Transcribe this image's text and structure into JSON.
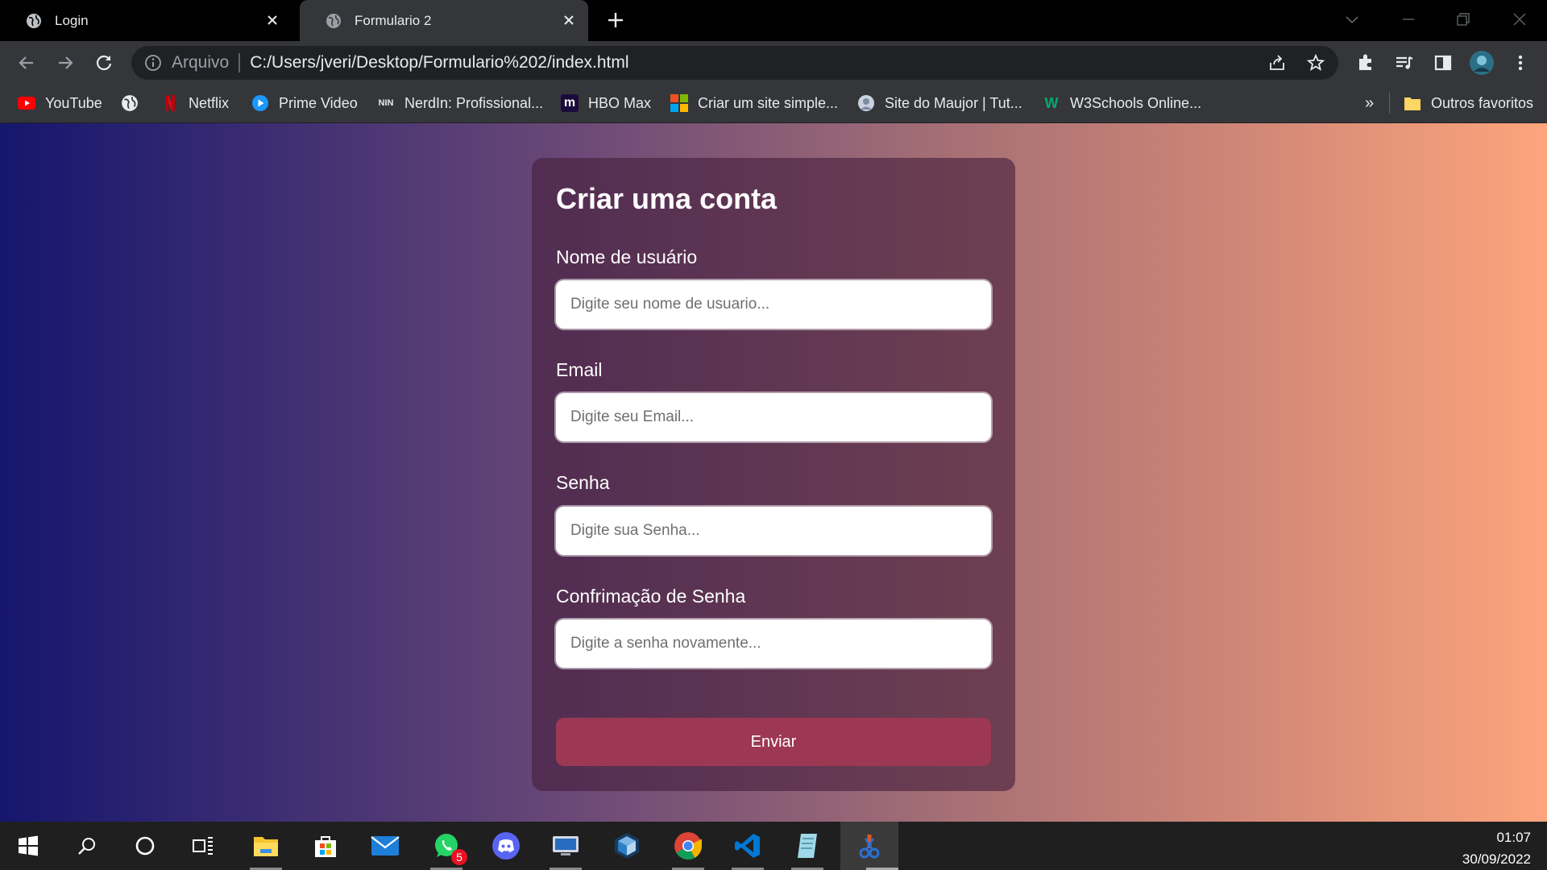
{
  "browser": {
    "tabs": [
      {
        "title": "Login",
        "active": false
      },
      {
        "title": "Formulario 2",
        "active": true
      }
    ],
    "address_bar": {
      "protocol_label": "Arquivo",
      "url": "C:/Users/jveri/Desktop/Formulario%202/index.html"
    },
    "bookmarks": [
      {
        "label": "YouTube",
        "icon": "youtube-icon"
      },
      {
        "label": "",
        "icon": "globe-icon"
      },
      {
        "label": "Netflix",
        "icon": "netflix-icon"
      },
      {
        "label": "Prime Video",
        "icon": "prime-video-icon"
      },
      {
        "label": "NerdIn: Profissional...",
        "icon": "nerdin-icon"
      },
      {
        "label": "HBO Max",
        "icon": "hbo-max-icon"
      },
      {
        "label": "Criar um site simple...",
        "icon": "microsoft-icon"
      },
      {
        "label": "Site do Maujor | Tut...",
        "icon": "maujor-icon"
      },
      {
        "label": "W3Schools Online...",
        "icon": "w3schools-icon"
      }
    ],
    "bookmarks_overflow": "»",
    "other_bookmarks": "Outros favoritos"
  },
  "form": {
    "title": "Criar uma conta",
    "fields": [
      {
        "label": "Nome de usuário",
        "placeholder": "Digite seu nome de usuario..."
      },
      {
        "label": "Email",
        "placeholder": "Digite seu Email..."
      },
      {
        "label": "Senha",
        "placeholder": "Digite sua Senha..."
      },
      {
        "label": "Confrimação de Senha",
        "placeholder": "Digite a senha novamente..."
      }
    ],
    "submit_label": "Enviar"
  },
  "taskbar": {
    "whatsapp_badge": "5",
    "time": "01:07",
    "date": "30/09/2022"
  },
  "colors": {
    "gradient_start": "#15166e",
    "gradient_end": "#fda57c",
    "submit_button": "#9d3854"
  }
}
